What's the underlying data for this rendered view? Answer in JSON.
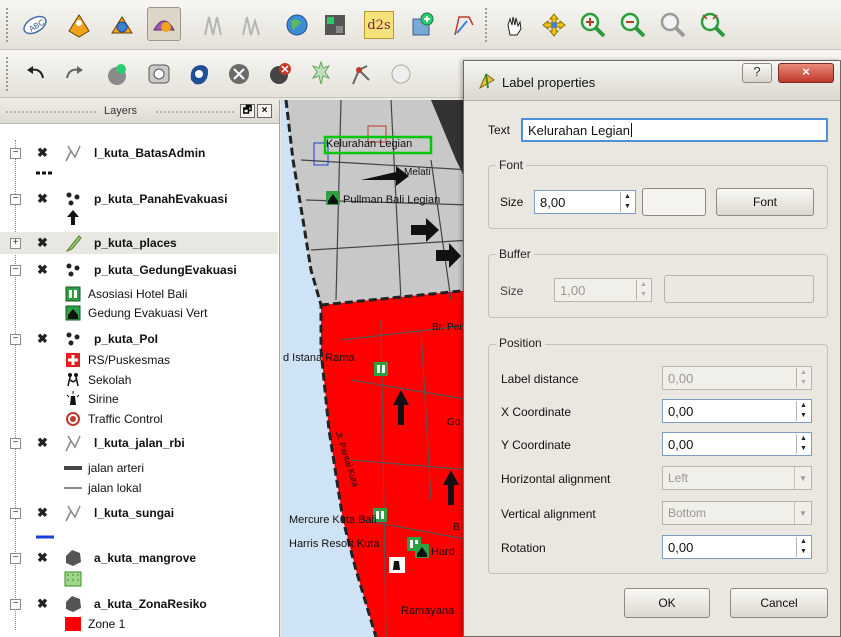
{
  "toolbar_top": {
    "icons": [
      "abc-label-icon",
      "move-label-icon",
      "rotate-label-icon",
      "change-label-icon",
      "pin-labels-icon",
      "show-hide-labels-icon",
      "globe-icon",
      "raster-calc-icon",
      "d2s-icon",
      "add-plugin-icon",
      "measure-icon",
      "pan-icon",
      "pan-to-selection-icon",
      "zoom-in-icon",
      "zoom-out-icon",
      "zoom-full-icon",
      "zoom-last-icon"
    ],
    "d2s_label": "d2s"
  },
  "toolbar_second": {
    "icons": [
      "undo-icon",
      "redo-icon",
      "add-feature-icon",
      "move-feature-icon",
      "rotate-feature-icon",
      "delete-part-icon",
      "delete-ring-icon",
      "split-icon",
      "node-tool-icon",
      "simplify-icon"
    ]
  },
  "layers_panel": {
    "title": "Layers",
    "float_label": "🗗",
    "close_label": "×",
    "layers": [
      {
        "name": "l_kuta_BatasAdmin",
        "expanded": true,
        "checked": "✖"
      },
      {
        "name": "p_kuta_PanahEvakuasi",
        "expanded": true,
        "checked": "✖"
      },
      {
        "name": "p_kuta_places",
        "expanded": false,
        "checked": "✖"
      },
      {
        "name": "p_kuta_GedungEvakuasi",
        "expanded": true,
        "checked": "✖"
      },
      {
        "name": "p_kuta_PoI",
        "expanded": true,
        "checked": "✖"
      },
      {
        "name": "l_kuta_jalan_rbi",
        "expanded": true,
        "checked": "✖"
      },
      {
        "name": "l_kuta_sungai",
        "expanded": true,
        "checked": "✖"
      },
      {
        "name": "a_kuta_mangrove",
        "expanded": true,
        "checked": "✖"
      },
      {
        "name": "a_kuta_ZonaResiko",
        "expanded": true,
        "checked": "✖"
      }
    ],
    "legend": {
      "gedung": [
        "Asosiasi Hotel Bali",
        "Gedung Evakuasi Vert"
      ],
      "poi": [
        "RS/Puskesmas",
        "Sekolah",
        "Sirine",
        "Traffic Control"
      ],
      "jalan": [
        "jalan arteri",
        "jalan lokal"
      ],
      "zona": [
        "Zone 1"
      ]
    }
  },
  "map": {
    "labels": {
      "kelurahan": "Kelurahan Legian",
      "melati": "Melati",
      "pullman": "Pullman Bali Legian",
      "br_pen": "Br. Pen",
      "istana": "d Istana Rama",
      "pantai": "Jl. Pantai Kuta",
      "go": "Go",
      "mercure": "Mercure Kuta Bali",
      "b": "B",
      "harris": "Harris Resort Kuta",
      "hard": "Hard",
      "ramayana": "Ramayana"
    },
    "colors": {
      "zone": "#ff0000",
      "land": "#c8c8c8",
      "sea": "#cfe3f6",
      "highlight": "#00c800"
    }
  },
  "dialog": {
    "title": "Label properties",
    "help_label": "?",
    "close_label": "×",
    "text_label": "Text",
    "text_value": "Kelurahan Legian",
    "font_group": "Font",
    "font_size_label": "Size",
    "font_size_value": "8,00",
    "font_button": "Font",
    "buffer_group": "Buffer",
    "buffer_size_label": "Size",
    "buffer_size_value": "1,00",
    "position_group": "Position",
    "label_distance_label": "Label distance",
    "label_distance_value": "0,00",
    "x_coord_label": "X Coordinate",
    "x_coord_value": "0,00",
    "y_coord_label": "Y Coordinate",
    "y_coord_value": "0,00",
    "h_align_label": "Horizontal alignment",
    "h_align_value": "Left",
    "v_align_label": "Vertical alignment",
    "v_align_value": "Bottom",
    "rotation_label": "Rotation",
    "rotation_value": "0,00",
    "ok_label": "OK",
    "cancel_label": "Cancel"
  }
}
